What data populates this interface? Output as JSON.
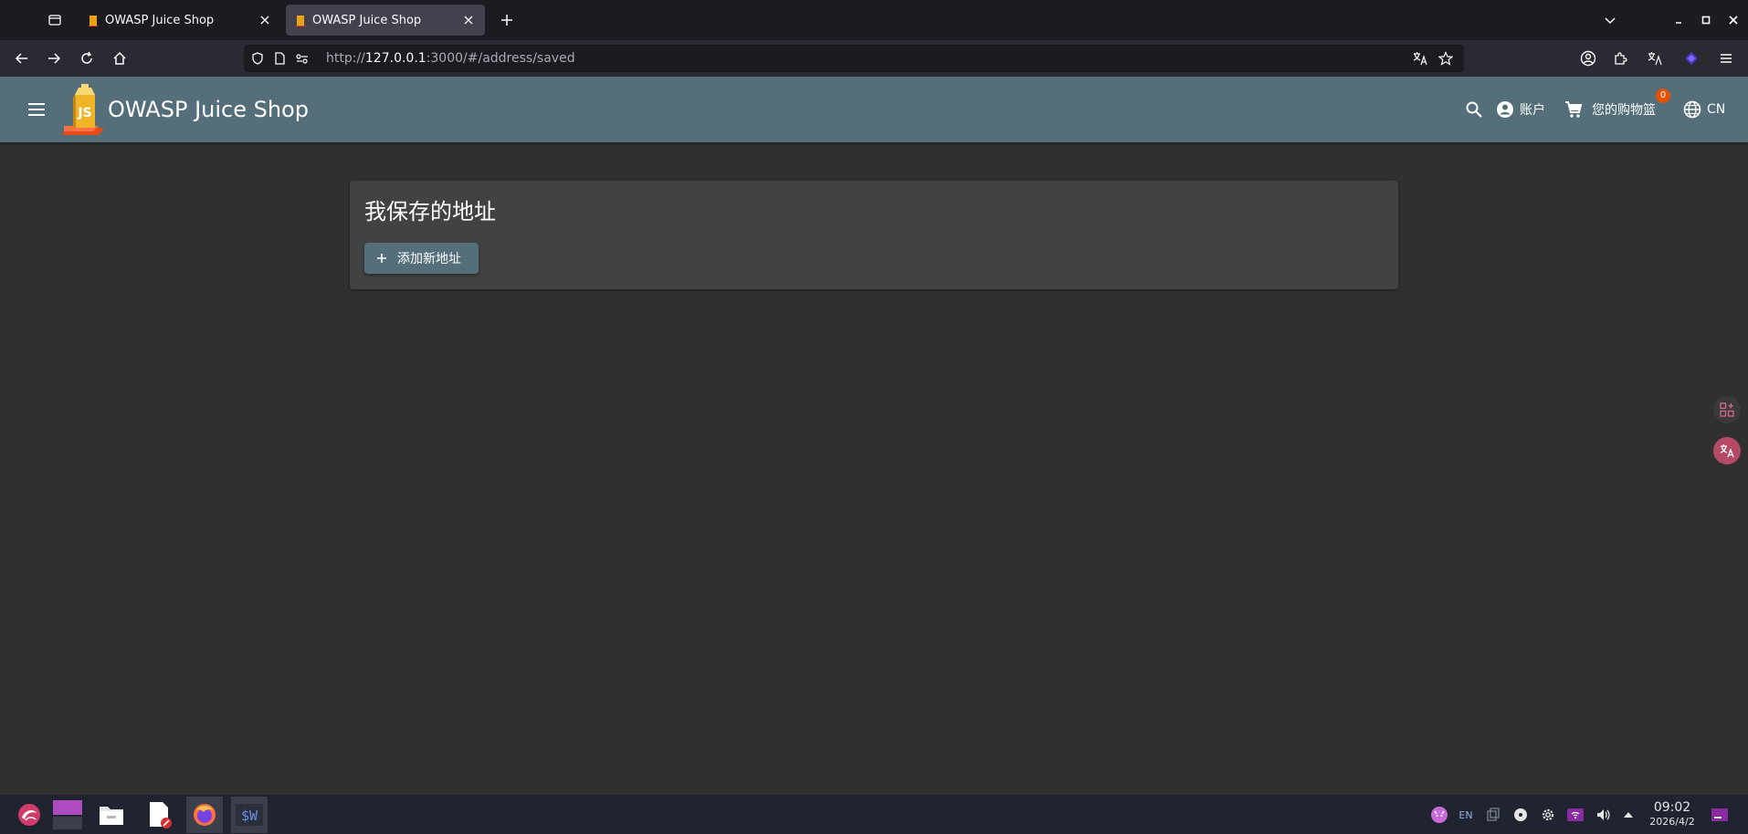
{
  "browser": {
    "tabs": [
      {
        "label": "OWASP Juice Shop",
        "active": false
      },
      {
        "label": "OWASP Juice Shop",
        "active": true
      }
    ],
    "url": {
      "scheme": "http://",
      "host": "127.0.0.1",
      "rest": ":3000/#/address/saved"
    }
  },
  "app": {
    "title": "OWASP Juice Shop",
    "account_label": "账户",
    "basket_label": "您的购物篮",
    "basket_count": "0",
    "language_label": "CN",
    "colors": {
      "toolbar": "#546e7a",
      "badge": "#e65100",
      "card": "#424242",
      "background": "#303030"
    }
  },
  "page": {
    "title": "我保存的地址",
    "add_button_label": "添加新地址"
  },
  "taskbar": {
    "tray_lang": "EN",
    "time": "09:02",
    "date": "2026/4/2"
  }
}
